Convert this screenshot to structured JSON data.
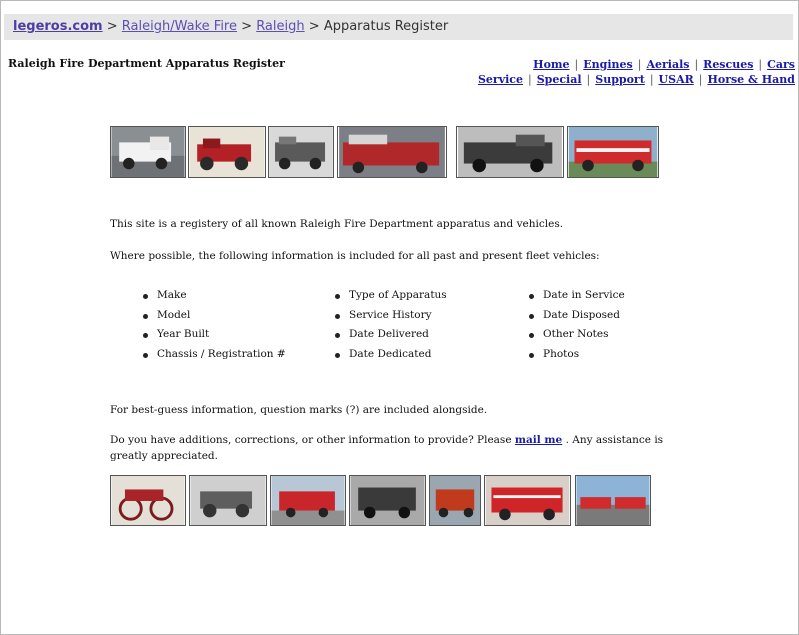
{
  "breadcrumb": {
    "home": "legeros.com",
    "sep1": ">",
    "dept": "Raleigh/Wake Fire",
    "sep2": ">",
    "city": "Raleigh",
    "sep3": ">",
    "current": "Apparatus Register"
  },
  "page": {
    "title": "Raleigh Fire Department Apparatus Register"
  },
  "nav": {
    "row1": [
      "Home",
      "Engines",
      "Aerials",
      "Rescues",
      "Cars"
    ],
    "row2": [
      "Service",
      "Special",
      "Support",
      "USAR",
      "Horse & Hand"
    ]
  },
  "intro": "This site is a registery of all known Raleigh Fire Department apparatus and vehicles.",
  "where_possible": "Where possible, the following information is included for all past and present fleet vehicles:",
  "fields": {
    "col1": [
      "Make",
      "Model",
      "Year Built",
      "Chassis / Registration #"
    ],
    "col2": [
      "Type of Apparatus",
      "Service History",
      "Date Delivered",
      "Date Dedicated"
    ],
    "col3": [
      "Date in Service",
      "Date Disposed",
      "Other Notes",
      "Photos"
    ]
  },
  "best_guess": "For best-guess information, question marks (?) are included alongside.",
  "contact": {
    "before": "Do you have additions, corrections, or other information to provide? Please",
    "link": "mail me",
    "after": ".  Any assistance is greatly appreciated."
  },
  "colors": {
    "link": "#1a1aa8",
    "breadcrumb_link": "#5a4fb4",
    "breadcrumb_bg": "#e6e6e6",
    "truck_red": "#c0282a"
  }
}
